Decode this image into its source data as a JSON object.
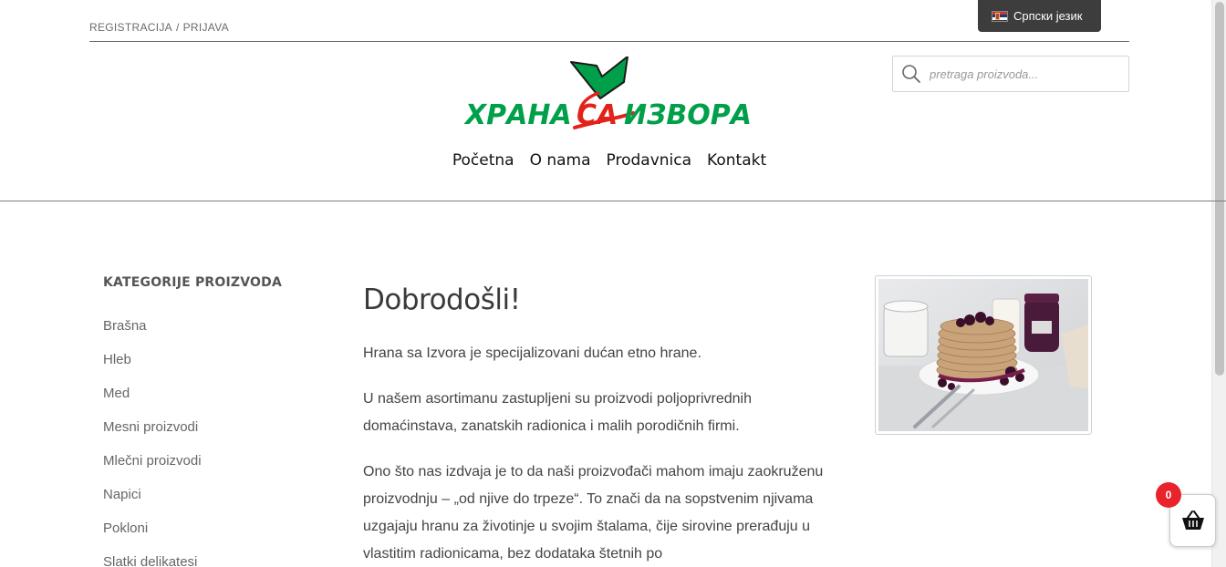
{
  "header": {
    "auth": {
      "register": "REGISTRACIJA",
      "separator": "/",
      "login": "PRIJAVA"
    },
    "language": {
      "label": "Српски језик",
      "flag": "serbia-flag-icon"
    },
    "search": {
      "placeholder": "pretraga proizvoda..."
    },
    "logo": {
      "text": "ХРАНА СА ИЗВОРА",
      "colors": {
        "green": "#00a04a",
        "red": "#e2231a"
      }
    },
    "nav": [
      "Početna",
      "O nama",
      "Prodavnica",
      "Kontakt"
    ]
  },
  "sidebar": {
    "title": "KATEGORIJE PROIZVODA",
    "items": [
      "Brašna",
      "Hleb",
      "Med",
      "Mesni proizvodi",
      "Mlečni proizvodi",
      "Napici",
      "Pokloni",
      "Slatki delikatesi"
    ]
  },
  "main": {
    "heading": "Dobrodošli!",
    "paragraphs": [
      "Hrana sa Izvora je specijalizovani dućan etno hrane.",
      "U našem asortimanu zastupljeni su proizvodi poljoprivrednih domaćinstava, zanatskih radionica i malih porodičnih firmi.",
      "Ono što nas izdvaja je to da  naši proizvođači mahom imaju zaokruženu proizvodnju – „od njive do trpeze“. To znači  da na sopstvenim njivama uzgajaju hranu za životinje u svojim štalama, čije sirovine prerađuju u vlastitim radionicama, bez dodataka štetnih po"
    ],
    "image": {
      "label": ""
    }
  },
  "cart": {
    "count": "0",
    "icon": "shopping-basket-icon"
  }
}
